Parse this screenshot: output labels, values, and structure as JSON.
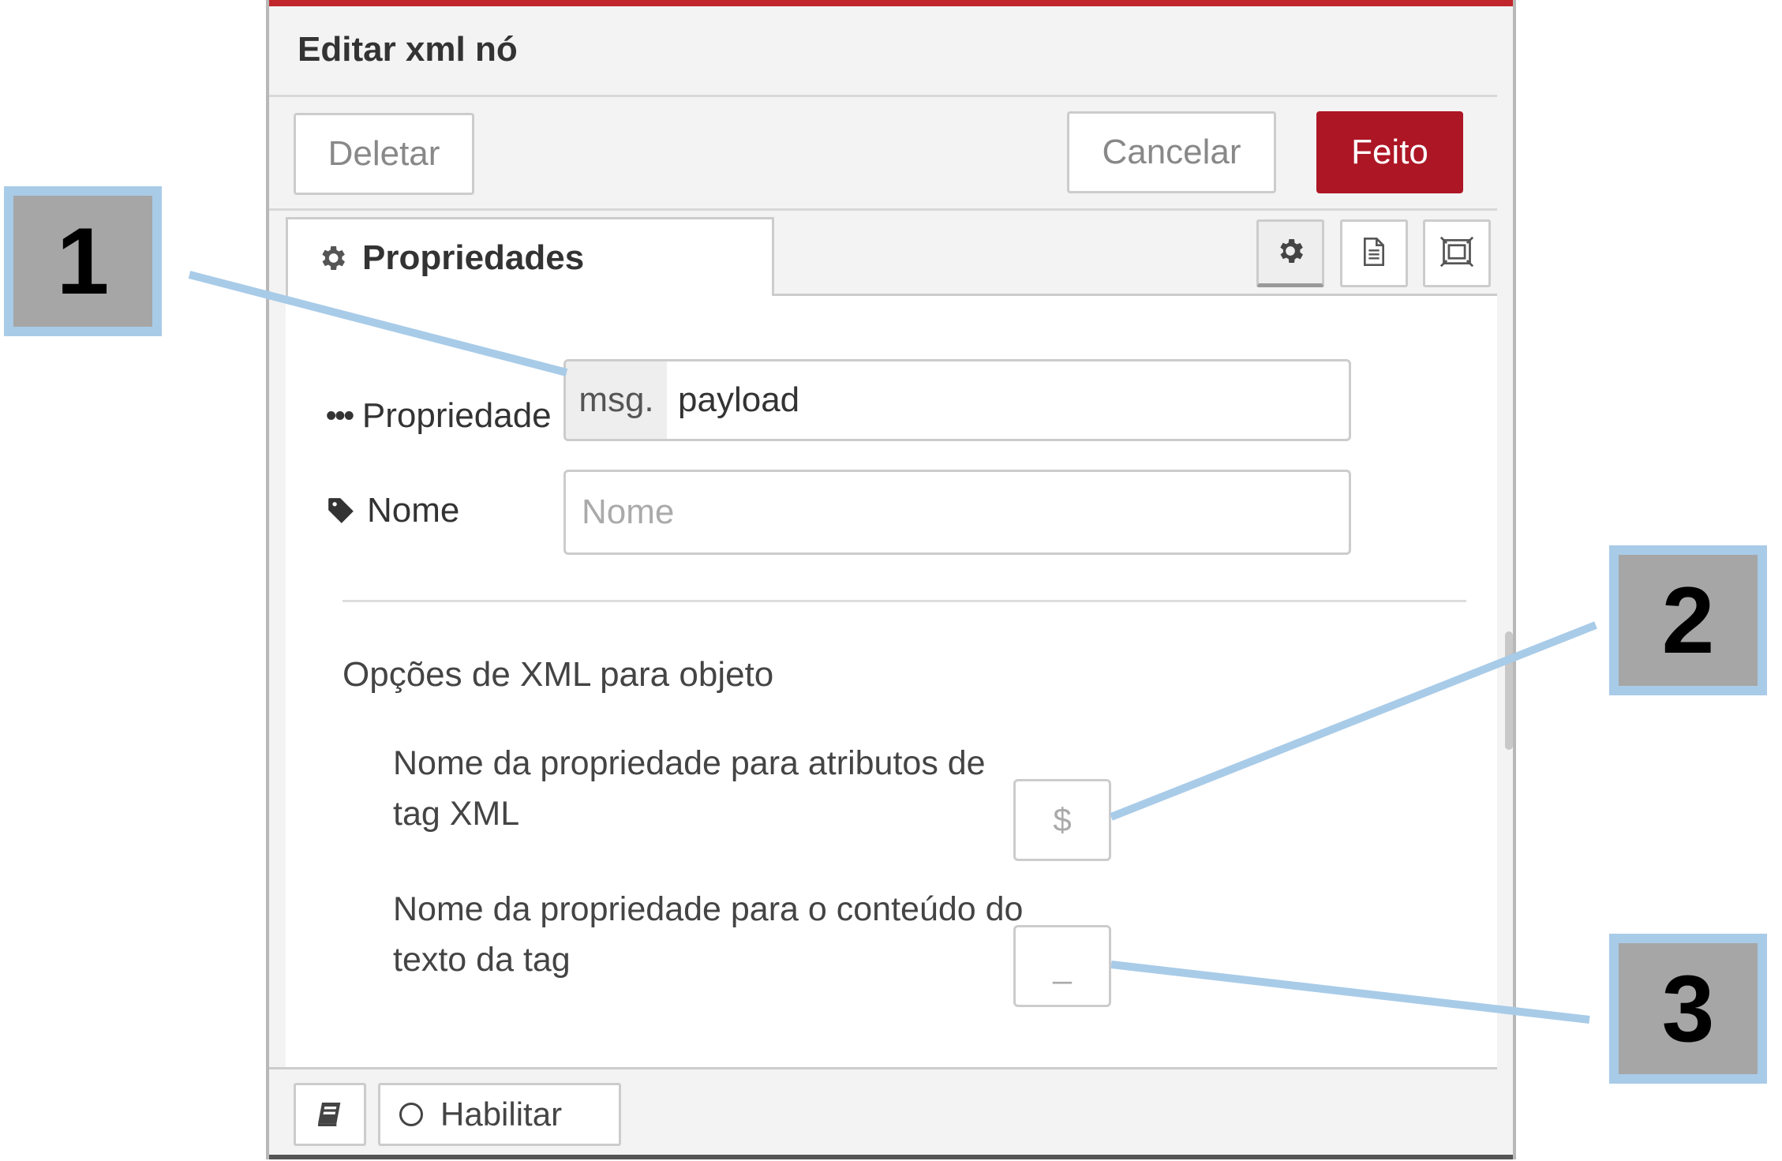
{
  "dialog": {
    "title": "Editar xml nó",
    "delete_label": "Deletar",
    "cancel_label": "Cancelar",
    "done_label": "Feito"
  },
  "tabs": {
    "properties_label": "Propriedades",
    "icons": [
      "gear-icon",
      "document-icon",
      "frame-icon"
    ]
  },
  "form": {
    "property_label": "Propriedade",
    "property_type": "msg.",
    "property_value": "payload",
    "name_label": "Nome",
    "name_placeholder": "Nome"
  },
  "options": {
    "section_title": "Opções de XML para objeto",
    "attr_label": "Nome da propriedade para atributos de tag XML",
    "attr_placeholder": "$",
    "text_label": "Nome da propriedade para o conteúdo do texto da tag",
    "text_placeholder": "_"
  },
  "footer": {
    "enable_label": "Habilitar",
    "book_icon": "book-icon"
  },
  "callouts": [
    "1",
    "2",
    "3"
  ],
  "colors": {
    "accent": "#ad1625",
    "topbar": "#c0262c",
    "callout_fill": "#a6a6a6",
    "callout_border": "#a8cbe8"
  }
}
